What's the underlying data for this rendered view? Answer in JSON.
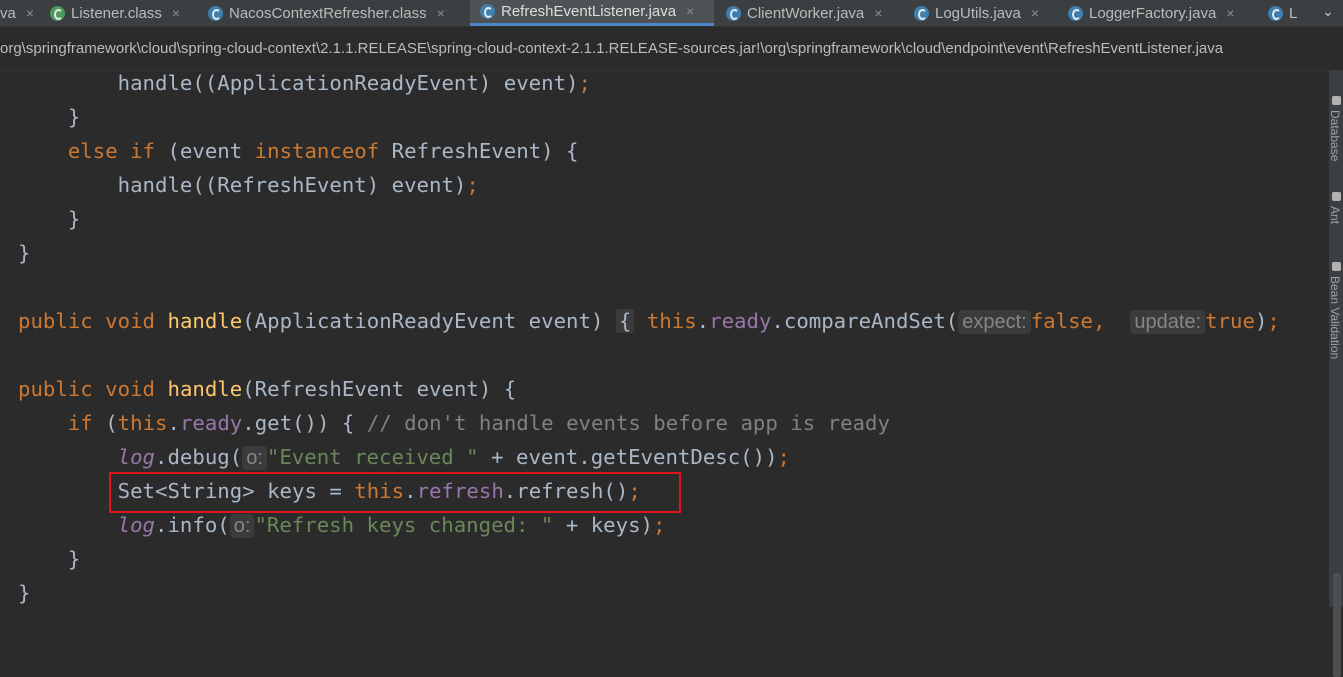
{
  "tabs": [
    {
      "label": "va",
      "icon": "none"
    },
    {
      "label": "Listener.class",
      "icon": "class-icon"
    },
    {
      "label": "NacosContextRefresher.class",
      "icon": "java-class-icon"
    },
    {
      "label": "RefreshEventListener.java",
      "icon": "java-class-icon",
      "active": true
    },
    {
      "label": "ClientWorker.java",
      "icon": "java-class-icon"
    },
    {
      "label": "LogUtils.java",
      "icon": "java-class-icon"
    },
    {
      "label": "LoggerFactory.java",
      "icon": "java-class-icon"
    },
    {
      "label": "L",
      "icon": "java-class-icon"
    }
  ],
  "close_glyph": "×",
  "chevron_glyph": "⌄",
  "breadcrumb": "org\\springframework\\cloud\\spring-cloud-context\\2.1.1.RELEASE\\spring-cloud-context-2.1.1.RELEASE-sources.jar!\\org\\springframework\\cloud\\endpoint\\event\\RefreshEventListener.java",
  "code": {
    "l1": {
      "a": "handle((ApplicationReadyEvent) event)",
      "semi": ";"
    },
    "l2": {
      "a": "}"
    },
    "l3": {
      "kw": "else if",
      "a": " (event ",
      "kw2": "instanceof",
      "b": " RefreshEvent) {"
    },
    "l4": {
      "a": "handle((RefreshEvent) event)",
      "semi": ";"
    },
    "l5": {
      "a": "}"
    },
    "l6": {
      "a": "}"
    },
    "l7": {
      "kw": "public void",
      "fn": "handle",
      "a": "(ApplicationReadyEvent event)",
      "brace": "{",
      "this": "this",
      "dot": ".",
      "fld": "ready",
      "b": ".compareAndSet(",
      "hint1": "expect:",
      "v1": "false",
      "comma": ",",
      "hint2": "update:",
      "v2": "true",
      "c": ")",
      "semi": ";"
    },
    "l8": {
      "kw": "public void",
      "fn": "handle",
      "a": "(RefreshEvent event) {"
    },
    "l9": {
      "kw": "if",
      "a": " (",
      "this": "this",
      "dot": ".",
      "fld": "ready",
      "b": ".get()) { ",
      "cmt": "// don't handle events before app is ready"
    },
    "l10": {
      "log": "log",
      "a": ".debug(",
      "hint": "o:",
      "str": "\"Event received \"",
      "b": " + event.getEventDesc())",
      "semi": ";"
    },
    "l11": {
      "a": "Set<String> keys = ",
      "this": "this",
      "dot": ".",
      "fld": "refresh",
      "b": ".refresh()",
      "semi": ";"
    },
    "l12": {
      "log": "log",
      "a": ".info(",
      "hint": "o:",
      "str": "\"Refresh keys changed: \"",
      "b": " + keys)",
      "semi": ";"
    },
    "l13": {
      "a": "}"
    },
    "l14": {
      "a": "}"
    }
  },
  "sidebar": {
    "database": "Database",
    "ant": "Ant",
    "bean_validation": "Bean Validation"
  }
}
